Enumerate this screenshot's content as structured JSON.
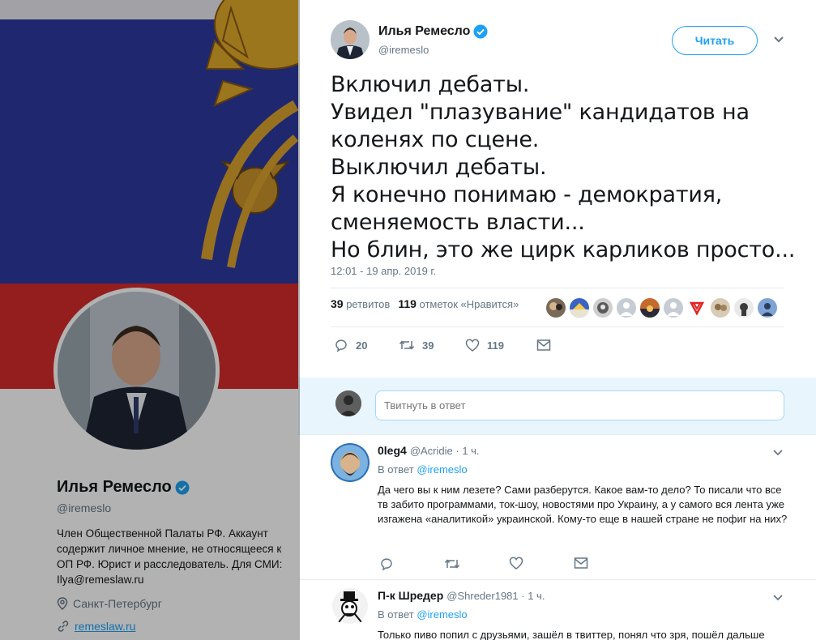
{
  "background_profile": {
    "name": "Илья Ремесло",
    "handle": "@iremeslo",
    "bio": "Член Общественной Палаты РФ. Аккаунт содержит личное мнение, не относящееся к ОП РФ. Юрист и расследователь. Для СМИ: Ilya@remeslaw.ru",
    "location": "Санкт-Петербург",
    "website": "remeslaw.ru"
  },
  "tweet": {
    "author_name": "Илья Ремесло",
    "author_handle": "@iremeslo",
    "follow_label": "Читать",
    "text_lines": [
      "Включил дебаты.",
      "Увидел \"плазувание\" кандидатов на",
      "коленях по сцене.",
      "Выключил дебаты.",
      "Я конечно понимаю - демократия,",
      "сменяемость власти...",
      "Но блин, это же цирк карликов просто..."
    ],
    "timestamp": "12:01 - 19 апр. 2019 г.",
    "retweets_count": "39",
    "retweets_label": "ретвитов",
    "likes_count": "119",
    "likes_label": "отметок «Нравится»",
    "actions": {
      "replies": "20",
      "retweets": "39",
      "likes": "119"
    }
  },
  "reply_box": {
    "placeholder": "Твитнуть в ответ"
  },
  "replies": [
    {
      "name": "0leg4",
      "handle": "@Acridie",
      "time": "· 1 ч.",
      "in_reply_prefix": "В ответ",
      "in_reply_to": "@iremeslo",
      "text": "Да чего вы к ним лезете? Сами разберутся. Какое вам-то дело? То писали что все тв забито программами, ток-шоу, новостями про Украину, а у самого вся лента уже изгажена «аналитикой» украинской. Кому-то еще в нашей стране не пофиг на них?"
    },
    {
      "name": "П-к Шредер",
      "handle": "@Shreder1981",
      "time": "· 1 ч.",
      "in_reply_prefix": "В ответ",
      "in_reply_to": "@iremeslo",
      "text": "Только пиво попил с друзьями, зашёл в твиттер, понял что зря, пошёл дальше"
    }
  ],
  "colors": {
    "accent": "#1da1f2",
    "text": "#14171a",
    "muted": "#657786",
    "divider": "#e6ecf0"
  }
}
